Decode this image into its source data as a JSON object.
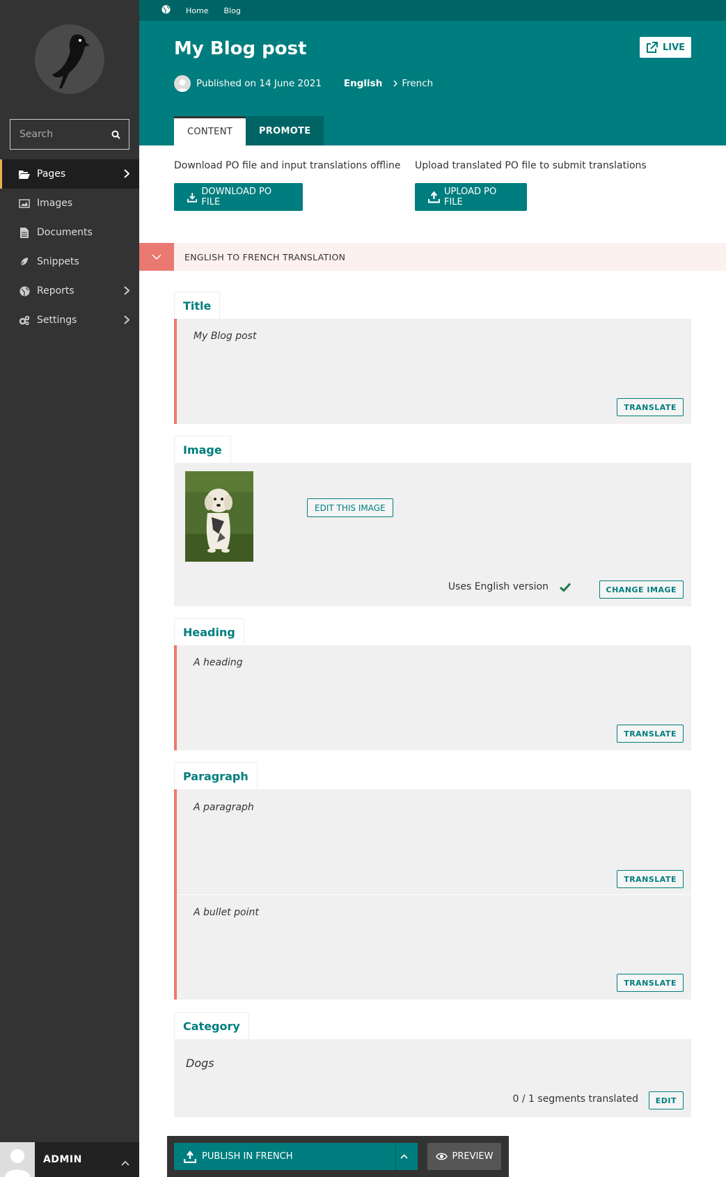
{
  "sidebar": {
    "search_placeholder": "Search",
    "items": [
      {
        "label": "Pages",
        "icon": "folder-open-icon"
      },
      {
        "label": "Images",
        "icon": "image-icon"
      },
      {
        "label": "Documents",
        "icon": "document-icon"
      },
      {
        "label": "Snippets",
        "icon": "snippet-icon"
      },
      {
        "label": "Reports",
        "icon": "globe-icon"
      },
      {
        "label": "Settings",
        "icon": "cogs-icon"
      }
    ],
    "account_name": "ADMIN"
  },
  "header": {
    "breadcrumb": [
      "Home",
      "Blog"
    ],
    "title": "My Blog post",
    "published": "Published on 14 June 2021",
    "source_language": "English",
    "target_language": "French",
    "live_label": "LIVE",
    "tabs": [
      "CONTENT",
      "PROMOTE"
    ]
  },
  "po": {
    "download_text": "Download PO file and input translations offline",
    "download_label": "DOWNLOAD PO FILE",
    "upload_text": "Upload translated PO file to submit translations",
    "upload_label": "UPLOAD PO FILE"
  },
  "translation": {
    "section_label": "ENGLISH TO FRENCH TRANSLATION",
    "fields": {
      "title": {
        "label": "Title",
        "segment": "My Blog post",
        "action": "TRANSLATE"
      },
      "image": {
        "label": "Image",
        "edit_label": "EDIT THIS IMAGE",
        "status": "Uses English version",
        "action": "CHANGE IMAGE"
      },
      "heading": {
        "label": "Heading",
        "segment": "A heading",
        "action": "TRANSLATE"
      },
      "paragraph": {
        "label": "Paragraph",
        "segments": [
          "A paragraph",
          "A bullet point"
        ],
        "action": "TRANSLATE"
      },
      "category": {
        "label": "Category",
        "value": "Dogs",
        "count": "0 / 1 segments translated",
        "action": "EDIT"
      }
    }
  },
  "footer": {
    "publish_label": "PUBLISH IN FRENCH",
    "preview_label": "PREVIEW"
  },
  "colors": {
    "primary": "#007d7e",
    "primary_dark": "#006465",
    "sidebar": "#333333",
    "alert": "#e97971",
    "success": "#1b7a4c"
  }
}
